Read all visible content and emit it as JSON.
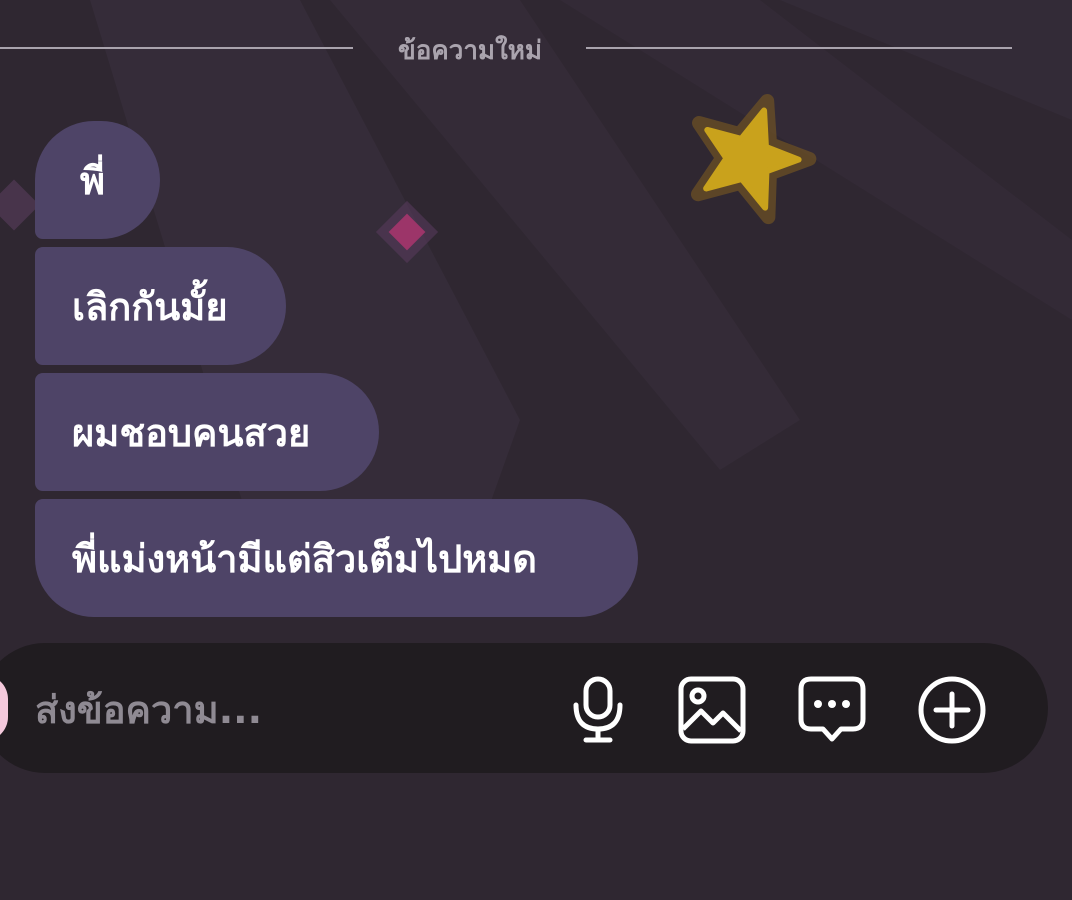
{
  "divider": {
    "label": "ข้อความใหม่"
  },
  "messages": [
    {
      "text": "พี่"
    },
    {
      "text": "เลิกกันมั้ย"
    },
    {
      "text": "ผมชอบคนสวย"
    },
    {
      "text": "พี่แม่งหน้ามีแต่สิวเต็มไปหมด"
    }
  ],
  "composer": {
    "placeholder": "ส่งข้อความ...",
    "icons": [
      "microphone-icon",
      "image-icon",
      "chat-bubble-icon",
      "plus-circle-icon"
    ]
  },
  "colors": {
    "background": "#2f2731",
    "bubble": "#4e4467",
    "input_bar": "#201c20",
    "star": "#c9a21c"
  }
}
